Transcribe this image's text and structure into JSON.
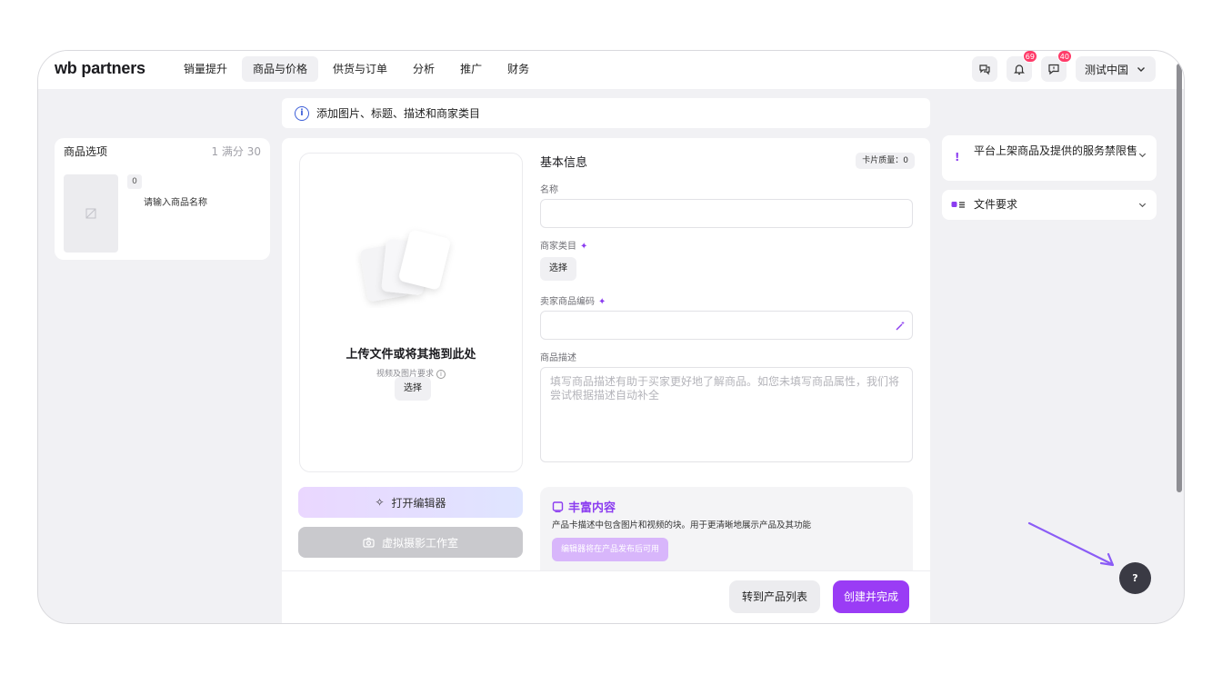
{
  "app": {
    "logo_prefix": "wb",
    "logo_suffix": "partners"
  },
  "nav": {
    "items": [
      "销量提升",
      "商品与价格",
      "供货与订单",
      "分析",
      "推广",
      "财务"
    ],
    "active_index": 1
  },
  "header": {
    "notifications_badge": "69",
    "messages_badge": "40",
    "account_name": "测试中国"
  },
  "banner": {
    "text": "添加图片、标题、描述和商家类目"
  },
  "options_panel": {
    "title": "商品选项",
    "count": "1 满分 30",
    "item_number": "0",
    "item_name": "请输入商品名称"
  },
  "upload": {
    "title": "上传文件或将其拖到此处",
    "subtitle": "视频及图片要求",
    "select_label": "选择",
    "editor_label": "打开编辑器",
    "studio_label": "虚拟摄影工作室"
  },
  "form": {
    "section_title": "基本信息",
    "card_quality": "卡片质量：0",
    "name_label": "名称",
    "name_value": "",
    "category_label": "商家类目",
    "category_button": "选择",
    "sku_label": "卖家商品编码",
    "sku_value": "",
    "description_label": "商品描述",
    "description_placeholder": "填写商品描述有助于买家更好地了解商品。如您未填写商品属性，我们将尝试根据描述自动补全"
  },
  "rich_content": {
    "title": "丰富内容",
    "description": "产品卡描述中包含图片和视频的块。用于更清晰地展示产品及其功能",
    "button": "编辑器将在产品发布后可用"
  },
  "footer": {
    "list_button": "转到产品列表",
    "create_button": "创建并完成"
  },
  "right_panel": {
    "restrictions_title": "平台上架商品及提供的服务禁限售",
    "file_requirements_title": "文件要求"
  },
  "help": {
    "label": "?"
  },
  "colors": {
    "accent": "#9a3cf5",
    "badge": "#ff3b69",
    "info": "#3d5fd8",
    "arrow": "#8b5cf6"
  }
}
